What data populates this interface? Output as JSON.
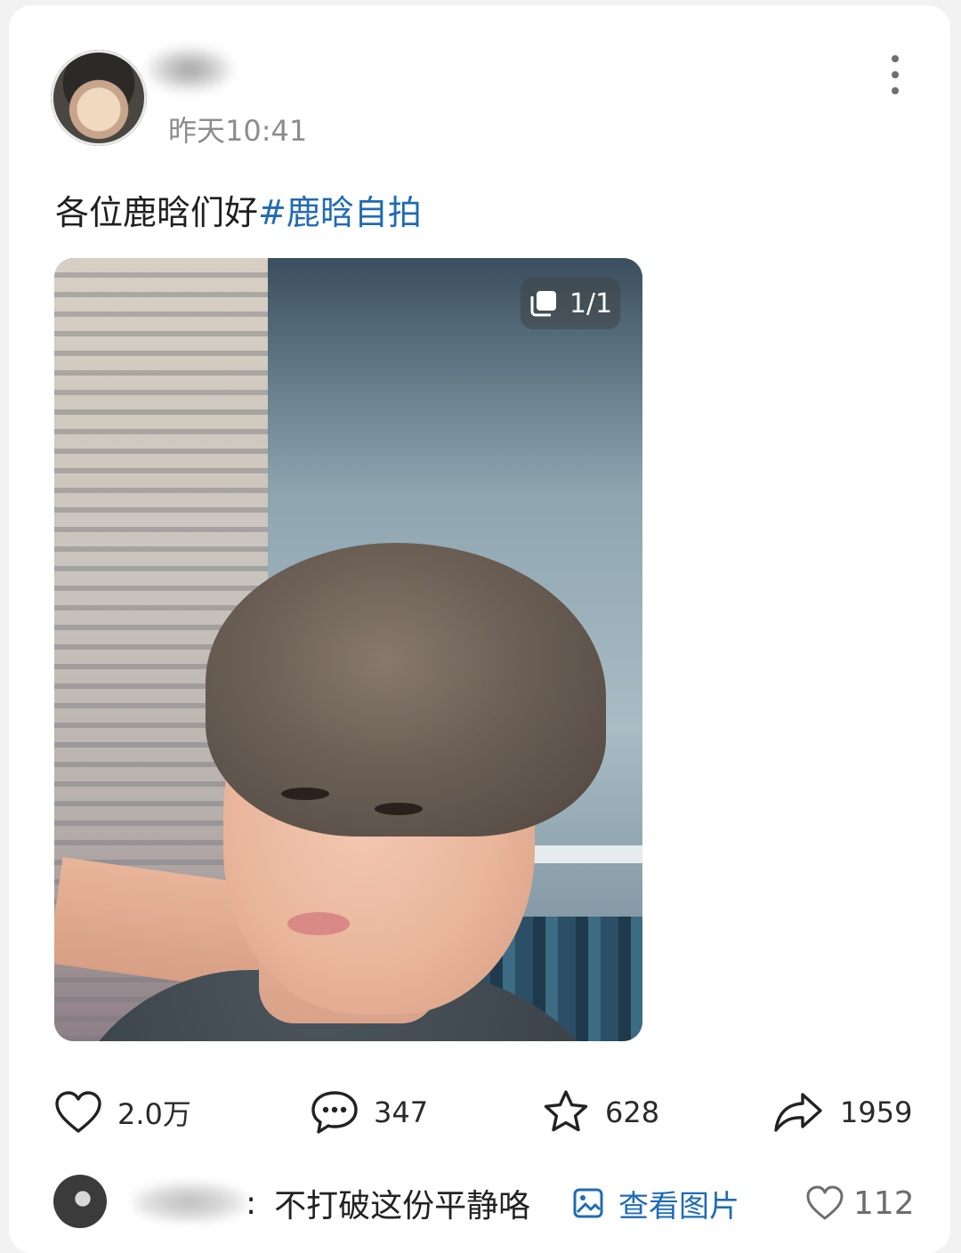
{
  "post": {
    "time": "昨天10:41",
    "text": "各位鹿晗们好",
    "hashtag": "#鹿晗自拍",
    "image_counter": "1/1"
  },
  "actions": {
    "like_count": "2.0万",
    "comment_count": "347",
    "favorite_count": "628",
    "share_count": "1959"
  },
  "top_comment": {
    "separator": ":",
    "text": "不打破这份平静咯",
    "view_image_label": "查看图片",
    "like_count": "112"
  },
  "colors": {
    "link_blue": "#1f6bb5",
    "time_gray": "#8c8c8c"
  },
  "icons": [
    "more-icon",
    "image-stack-icon",
    "heart-icon",
    "comment-icon",
    "star-icon",
    "share-icon",
    "image-icon"
  ]
}
